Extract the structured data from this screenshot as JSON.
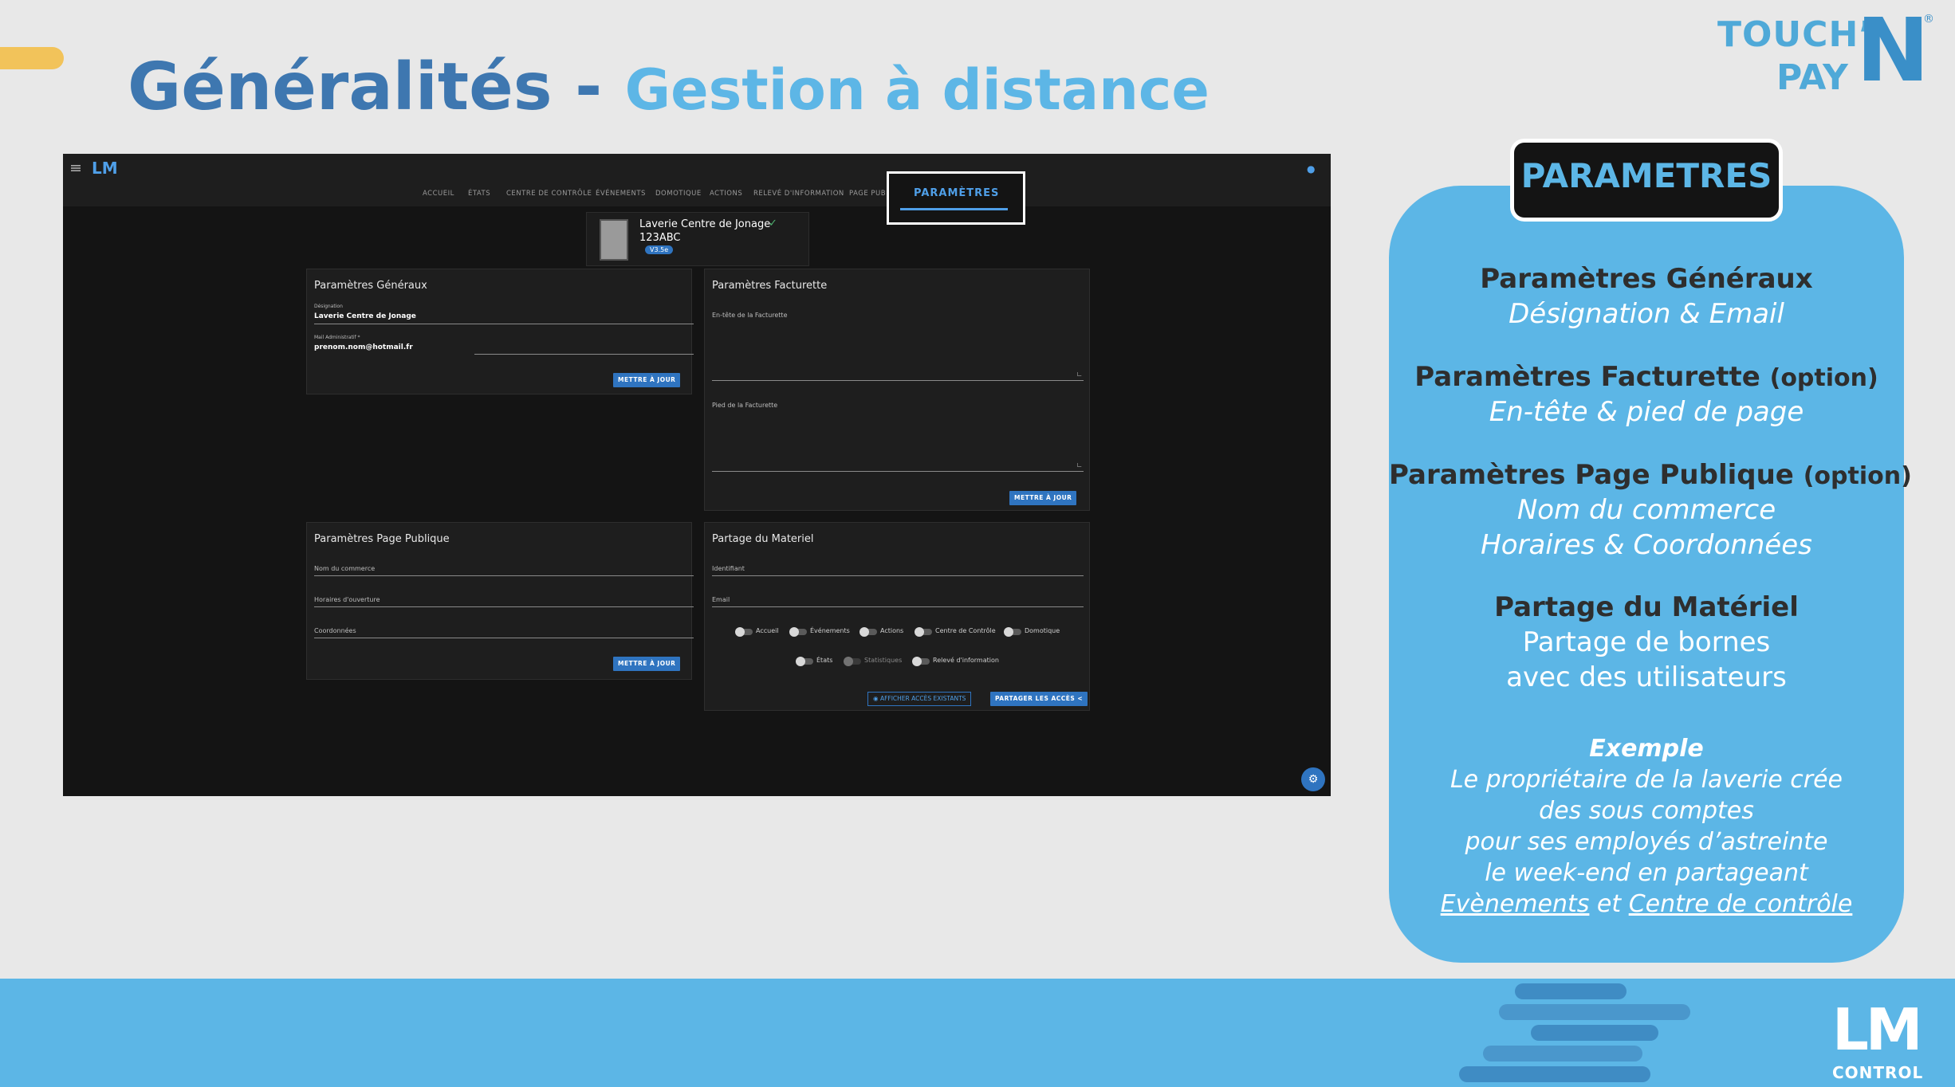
{
  "slide": {
    "title_main": "Généralités",
    "title_sep": " - ",
    "title_sub": "Gestion à distance",
    "logo_touch": "TOUCH’",
    "logo_pay": "PAY",
    "logo_n": "N",
    "logo_reg": "®",
    "footer_logo_lm": "LM",
    "footer_logo_control": "CONTROL"
  },
  "app": {
    "logo": "LM",
    "nav": [
      "ACCUEIL",
      "ÉTATS",
      "CENTRE DE CONTRÔLE",
      "ÉVÉNEMENTS",
      "DOMOTIQUE",
      "ACTIONS",
      "RELEVÉ D'INFORMATION",
      "PAGE PUBL"
    ],
    "nav_active": "PARAMÈTRES",
    "device": {
      "name": "Laverie Centre de Jonage",
      "code": "123ABC",
      "badge": "V3.5e",
      "check": "✓"
    },
    "general": {
      "title": "Paramètres Généraux",
      "designation_label": "Désignation",
      "designation_value": "Laverie Centre de Jonage",
      "email_label": "Mail Administratif *",
      "email_value": "prenom.nom@hotmail.fr",
      "button": "METTRE À JOUR"
    },
    "facturette": {
      "title": "Paramètres Facturette",
      "header_label": "En-tête de la Facturette",
      "footer_label": "Pied de la Facturette",
      "button": "METTRE À JOUR"
    },
    "public_page": {
      "title": "Paramètres Page Publique",
      "name_label": "Nom du commerce",
      "hours_label": "Horaires d'ouverture",
      "coords_label": "Coordonnées",
      "button": "METTRE À JOUR"
    },
    "sharing": {
      "title": "Partage du Materiel",
      "id_label": "Identifiant",
      "email_label": "Email",
      "toggles_row1": [
        "Accueil",
        "Événements",
        "Actions",
        "Centre de Contrôle",
        "Domotique"
      ],
      "toggles_row2": [
        "États",
        "Statistiques",
        "Relevé d'information"
      ],
      "show_button": "AFFICHER ACCÈS EXISTANTS",
      "share_button": "PARTAGER LES ACCÈS"
    }
  },
  "info": {
    "header": "PARAMETRES",
    "s1_title": "Paramètres Généraux",
    "s1_sub": "Désignation & Email",
    "s2_title": "Paramètres Facturette",
    "s2_opt": "(option)",
    "s2_sub": "En-tête & pied de page",
    "s3_title": "Paramètres Page Publique",
    "s3_opt": "(option)",
    "s3_sub1": "Nom du commerce",
    "s3_sub2": "Horaires & Coordonnées",
    "s4_title": "Partage du Matériel",
    "s4_sub1": "Partage de bornes",
    "s4_sub2": "avec des utilisateurs",
    "ex_title": "Exemple",
    "ex_line1": "Le propriétaire de la laverie crée",
    "ex_line2": "des sous comptes",
    "ex_line3": "pour ses employés d’astreinte",
    "ex_line4": "le week-end en partageant",
    "ex_link1": "Evènements",
    "ex_and": " et ",
    "ex_link2": "Centre de contrôle"
  }
}
